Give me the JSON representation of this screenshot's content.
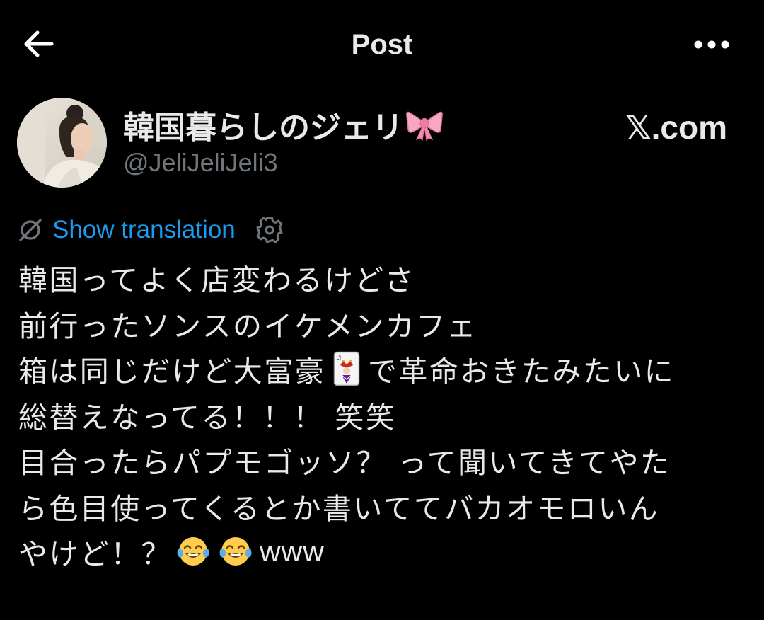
{
  "header": {
    "title": "Post",
    "back_icon": "arrow-left-icon",
    "more_icon": "more-horizontal-icon"
  },
  "author": {
    "display_name": "韓国暮らしのジェリ",
    "name_emoji": "ribbon-emoji",
    "handle": "@JeliJeliJeli3",
    "avatar": "avatar-photo"
  },
  "watermark": "𝕏.com",
  "translation": {
    "label": "Show translation",
    "icon": "globe-off-icon",
    "settings_icon": "gear-icon"
  },
  "post": {
    "line1": "韓国ってよく店変わるけどさ",
    "line2": "前行ったソンスのイケメンカフェ",
    "line3_a": "箱は同じだけど大富豪",
    "line3_emoji": "joker-card-emoji",
    "line3_b": "で革命おきたみたいに",
    "line4": "総替えなってる！！！ 笑笑",
    "line5": "目合ったらパプモゴッソ？ って聞いてきてやた",
    "line6": "ら色目使ってくるとか書いててバカオモロいん",
    "line7_a": "やけど！？ ",
    "line7_emoji": "tears-of-joy-emoji",
    "line7_b": "www"
  },
  "colors": {
    "background": "#000000",
    "text_primary": "#E7E9EA",
    "text_secondary": "#71767B",
    "link": "#1D9BF0",
    "ribbon": "#F7A6C4",
    "emoji_yellow": "#FFCC4D"
  }
}
